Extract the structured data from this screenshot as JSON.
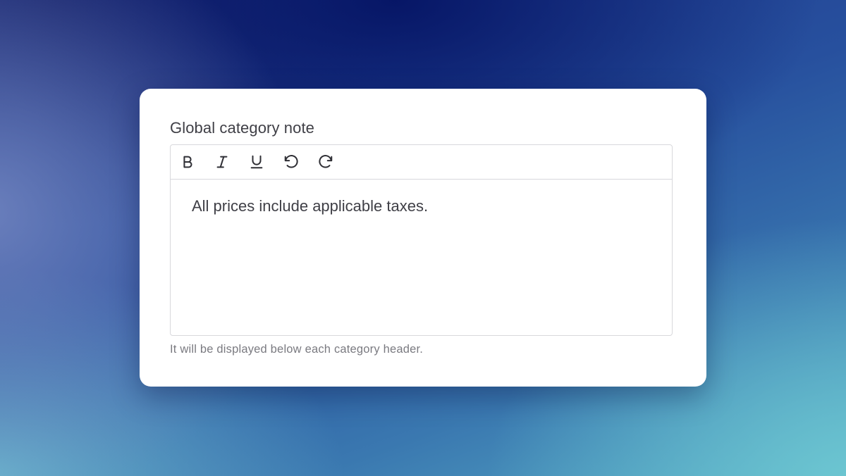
{
  "field": {
    "label": "Global category note",
    "content": "All prices include applicable taxes.",
    "hint": "It will be displayed below each category header."
  },
  "toolbar": {
    "tools": [
      {
        "name": "bold",
        "icon": "bold-icon"
      },
      {
        "name": "italic",
        "icon": "italic-icon"
      },
      {
        "name": "underline",
        "icon": "underline-icon"
      },
      {
        "name": "undo",
        "icon": "undo-icon"
      },
      {
        "name": "redo",
        "icon": "redo-icon"
      }
    ]
  },
  "colors": {
    "text": "#3f3f46",
    "hint": "#7a7a80",
    "border": "#d8d8dc",
    "card": "#ffffff"
  }
}
